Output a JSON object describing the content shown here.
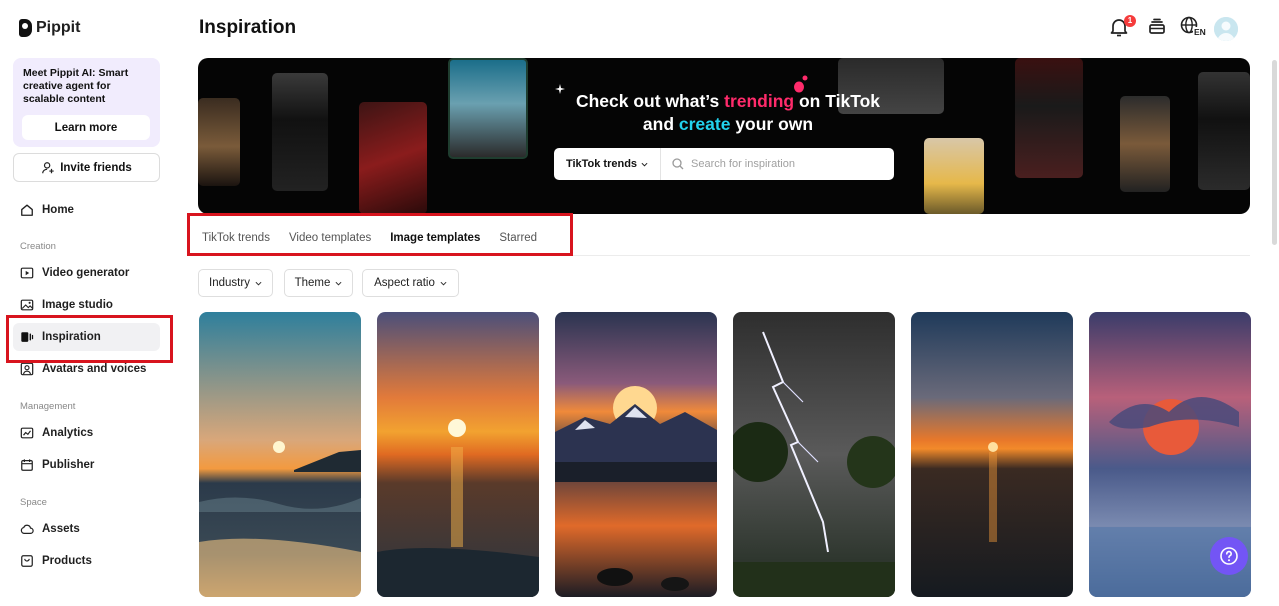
{
  "app": {
    "name": "Pippit"
  },
  "sidebar": {
    "promo": {
      "text": "Meet Pippit AI: Smart creative agent for scalable content",
      "button": "Learn more"
    },
    "invite": "Invite friends",
    "home": "Home",
    "sections": {
      "creation": "Creation",
      "management": "Management",
      "space": "Space"
    },
    "creation_items": [
      "Video generator",
      "Image studio",
      "Inspiration",
      "Avatars and voices"
    ],
    "management_items": [
      "Analytics",
      "Publisher"
    ],
    "space_items": [
      "Assets",
      "Products"
    ]
  },
  "header": {
    "title": "Inspiration",
    "notification_count": "1",
    "language": "EN"
  },
  "banner": {
    "line1_pre": "Check out what’s ",
    "line1_accent": "trending",
    "line1_post": " on TikTok",
    "line2_pre": "and ",
    "line2_accent": "create",
    "line2_post": " your own",
    "select_label": "TikTok trends",
    "search_placeholder": "Search for inspiration",
    "colors": {
      "pink": "#ff2b6b",
      "cyan": "#22d3ee"
    }
  },
  "tabs": [
    {
      "label": "TikTok trends",
      "active": false
    },
    {
      "label": "Video templates",
      "active": false
    },
    {
      "label": "Image templates",
      "active": true
    },
    {
      "label": "Starred",
      "active": false
    }
  ],
  "filters": [
    "Industry",
    "Theme",
    "Aspect ratio"
  ],
  "cards": [
    {
      "subject": "sunset over ocean beach"
    },
    {
      "subject": "orange sunset over sea"
    },
    {
      "subject": "sunset over mountain lake"
    },
    {
      "subject": "lightning storm over tree"
    },
    {
      "subject": "sunset on sea horizon"
    },
    {
      "subject": "red moon behind clouds"
    }
  ],
  "icons": [
    "bell-icon",
    "credits-icon",
    "globe-icon",
    "help-icon",
    "search-icon",
    "home-icon",
    "video-icon",
    "image-icon",
    "inspiration-icon",
    "avatar-icon",
    "analytics-icon",
    "calendar-icon",
    "cloud-icon",
    "product-icon"
  ],
  "highlight_color": "#d8141e",
  "accent_color": "#7355f5"
}
